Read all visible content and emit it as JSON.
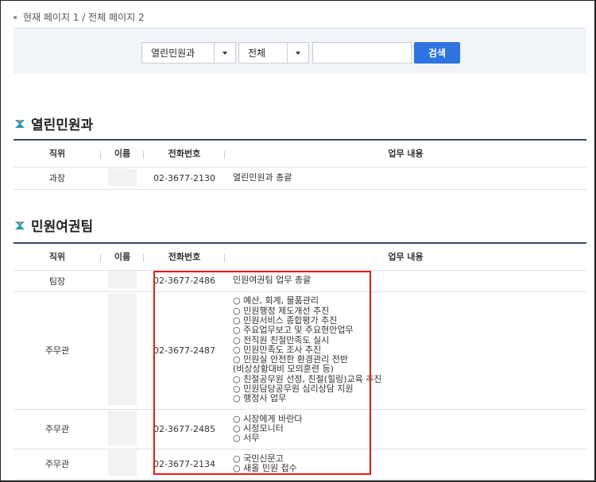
{
  "page_info": "현재 페이지 1 / 전체 페이지 2",
  "search": {
    "dept_select": "열린민원과",
    "field_select": "전체",
    "input_value": "",
    "button_label": "검색"
  },
  "sections": [
    {
      "title": "열린민원과",
      "headers": [
        "직위",
        "이름",
        "전화번호",
        "업무 내용"
      ],
      "rows": [
        {
          "position": "과장",
          "phone": "02-3677-2130",
          "tasks": [
            "열린민원과 총괄"
          ]
        }
      ]
    },
    {
      "title": "민원여권팀",
      "headers": [
        "직위",
        "이름",
        "전화번호",
        "업무 내용"
      ],
      "rows": [
        {
          "position": "팀장",
          "phone": "02-3677-2486",
          "tasks": [
            "민원여권팀 업무 총괄"
          ]
        },
        {
          "position": "주무관",
          "phone": "02-3677-2487",
          "tasks": [
            "○ 예산, 회계, 물품관리",
            "○ 민원행정 제도개선 추진",
            "○ 민원서비스 종합평가 추진",
            "○ 주요업무보고 및 주요현안업무",
            "○ 전직원 친절만족도 실시",
            "○ 민원만족도 조사 추진",
            "○ 민원실 안전한 환경관리 전반",
            "(비상상황대비 모의훈련 등)",
            "○ 친절공무원 선정, 친절(힐링)교육 추진",
            "○ 민원담당공무원 심리상담 지원",
            "○ 행정사 업무"
          ]
        },
        {
          "position": "주무관",
          "phone": "02-3677-2485",
          "tasks": [
            "○ 시장에게 바란다",
            "○ 시정모니터",
            "○ 서무"
          ]
        },
        {
          "position": "주무관",
          "phone": "02-3677-2134",
          "tasks": [
            "○ 국민신문고",
            "○ 새올 민원 접수"
          ]
        }
      ]
    }
  ],
  "colors": {
    "accent_blue": "#2f73e0",
    "highlight_red": "#e21d1d",
    "header_line": "#3b4a63"
  }
}
